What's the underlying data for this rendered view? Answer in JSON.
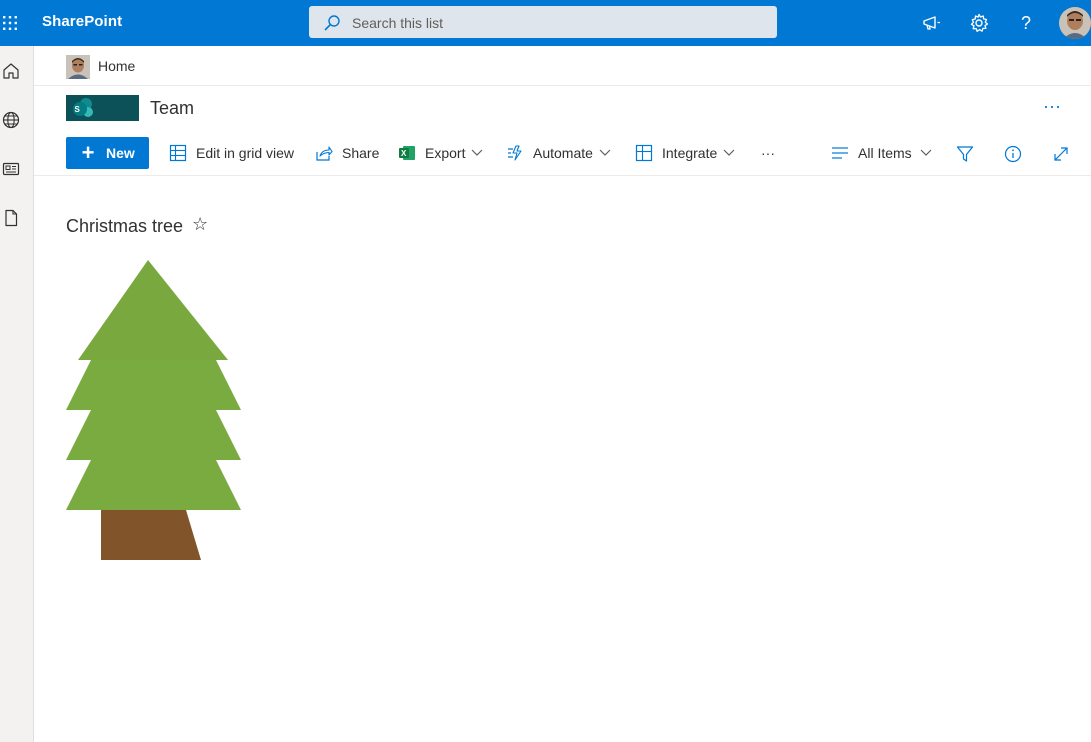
{
  "suite": {
    "brand": "SharePoint",
    "search_placeholder": "Search this list"
  },
  "breadcrumb": {
    "label": "Home"
  },
  "site": {
    "title": "Team",
    "more": "···"
  },
  "commands": {
    "new_label": "New",
    "edit_grid_label": "Edit in grid view",
    "share_label": "Share",
    "export_label": "Export",
    "automate_label": "Automate",
    "integrate_label": "Integrate",
    "more_label": "···",
    "view_label": "All Items"
  },
  "list": {
    "title": "Christmas tree",
    "star": "☆"
  },
  "icons": {
    "help": "?"
  },
  "colors": {
    "suite_bar": "#0078d4",
    "tree_green": "#7aab41",
    "trunk_brown": "#82542a",
    "site_logo": "#0b5157"
  }
}
